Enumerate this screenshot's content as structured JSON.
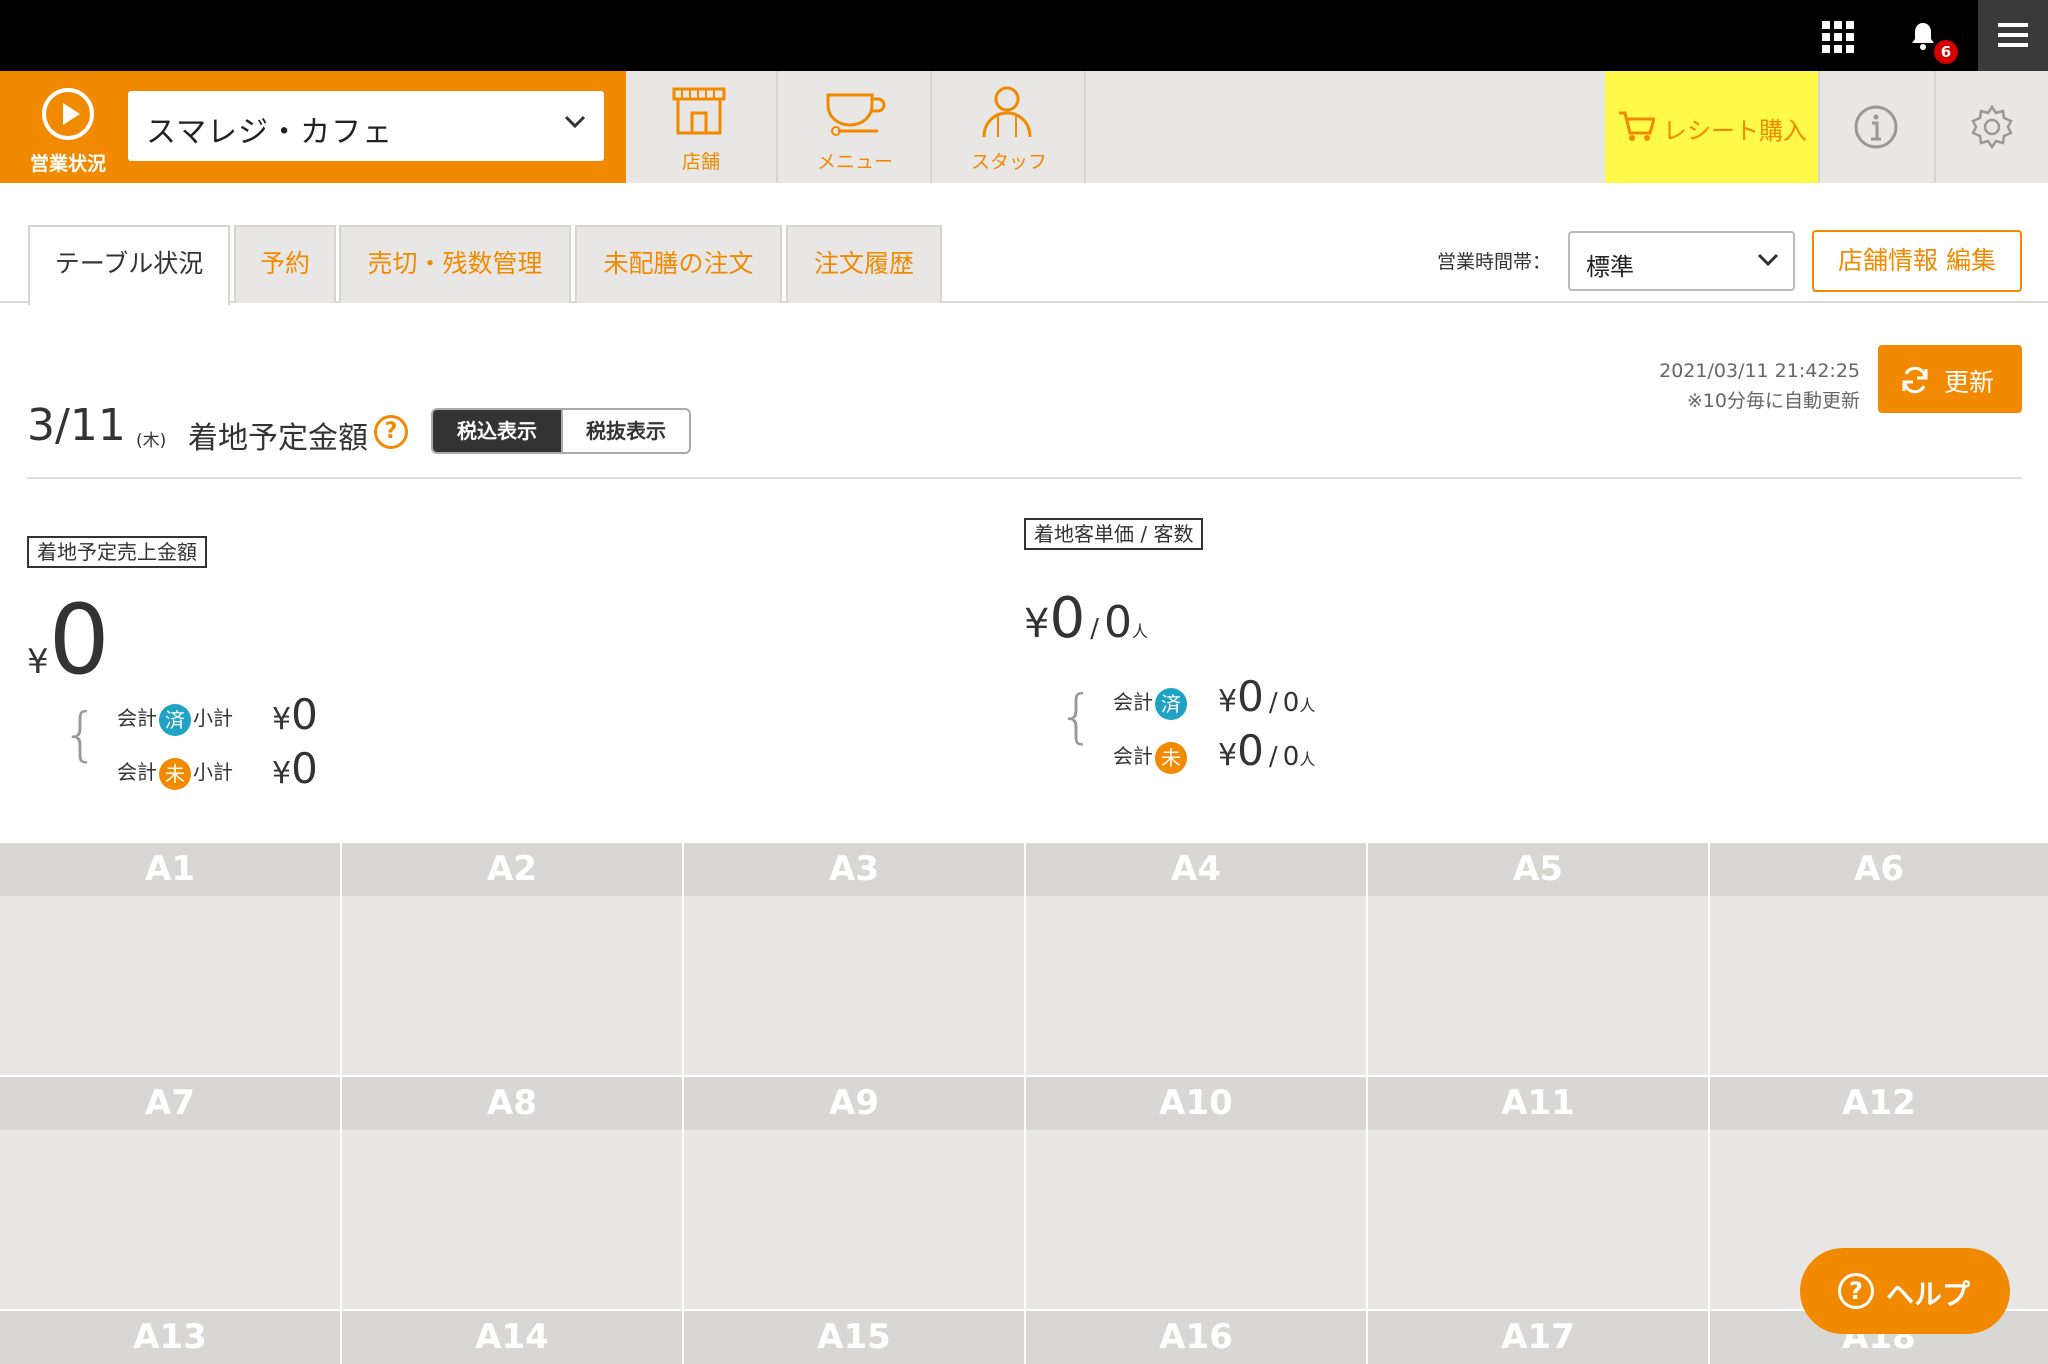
{
  "topbar": {
    "notification_count": "6"
  },
  "nav": {
    "status_label": "営業状況",
    "store": "スマレジ・カフェ",
    "items": [
      {
        "label": "店舗"
      },
      {
        "label": "メニュー"
      },
      {
        "label": "スタッフ"
      }
    ],
    "receipt_label": "レシート購入"
  },
  "tabs": [
    "テーブル状況",
    "予約",
    "売切・残数管理",
    "未配膳の注文",
    "注文履歴"
  ],
  "timeslot": {
    "label": "営業時間帯：",
    "value": "標準"
  },
  "edit_store_label": "店舗情報 編集",
  "update": {
    "timestamp": "2021/03/11 21:42:25",
    "note": "※10分毎に自動更新",
    "button": "更新"
  },
  "summary": {
    "date": "3/11",
    "weekday": "(木)",
    "title": "着地予定金額",
    "help": "?",
    "tax_on": "税込表示",
    "tax_off": "税抜表示"
  },
  "sales": {
    "label": "着地予定売上金額",
    "yen": "¥",
    "total": "0",
    "rows": [
      {
        "prefix": "会計",
        "badge": "済",
        "suffix": "小計",
        "yen": "¥",
        "value": "0"
      },
      {
        "prefix": "会計",
        "badge": "未",
        "suffix": "小計",
        "yen": "¥",
        "value": "0"
      }
    ]
  },
  "customers": {
    "label": "着地客単価 / 客数",
    "yen": "¥",
    "unit_price": "0",
    "slash": "/",
    "count": "0",
    "person": "人",
    "rows": [
      {
        "prefix": "会計",
        "badge": "済",
        "yen": "¥",
        "value": "0",
        "slash": "/",
        "count": "0",
        "person": "人"
      },
      {
        "prefix": "会計",
        "badge": "未",
        "yen": "¥",
        "value": "0",
        "slash": "/",
        "count": "0",
        "person": "人"
      }
    ]
  },
  "tables": [
    "A1",
    "A2",
    "A3",
    "A4",
    "A5",
    "A6",
    "A7",
    "A8",
    "A9",
    "A10",
    "A11",
    "A12",
    "A13",
    "A14",
    "A15",
    "A16",
    "A17",
    "A18"
  ],
  "help_label": "ヘルプ",
  "help_glyph": "?",
  "colors": {
    "accent": "#f18a00",
    "done": "#1fa2c4",
    "receipt_bg": "#fff94a",
    "table_header": "#d8d7d4"
  }
}
